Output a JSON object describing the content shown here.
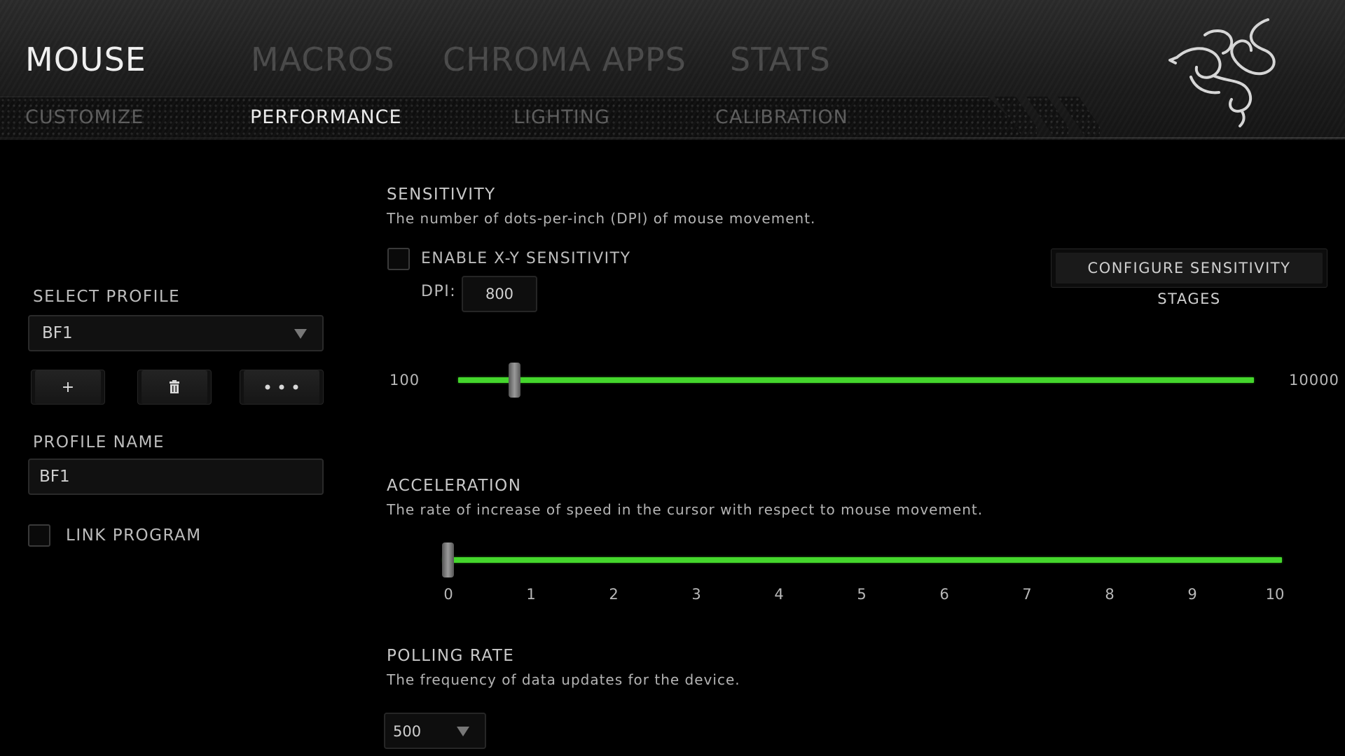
{
  "header": {
    "main_tabs": [
      {
        "label": "MOUSE",
        "active": true
      },
      {
        "label": "MACROS",
        "active": false
      },
      {
        "label": "CHROMA APPS",
        "active": false
      },
      {
        "label": "STATS",
        "active": false
      }
    ],
    "sub_tabs": [
      {
        "label": "CUSTOMIZE",
        "active": false
      },
      {
        "label": "PERFORMANCE",
        "active": true
      },
      {
        "label": "LIGHTING",
        "active": false
      },
      {
        "label": "CALIBRATION",
        "active": false
      }
    ],
    "logo_icon": "razer-snake-logo-icon"
  },
  "profile": {
    "select_label": "SELECT PROFILE",
    "selected": "BF1",
    "add_symbol": "+",
    "delete_icon": "trash-icon",
    "more_icon": "ellipsis-icon",
    "name_label": "PROFILE NAME",
    "name_value": "BF1",
    "link_program_label": "LINK PROGRAM",
    "link_program_checked": false
  },
  "sensitivity": {
    "title": "SENSITIVITY",
    "description": "The number of dots-per-inch (DPI) of mouse movement.",
    "enable_xy_label": "ENABLE X-Y SENSITIVITY",
    "enable_xy_checked": false,
    "dpi_label": "DPI:",
    "dpi_value": "800",
    "configure_button": "CONFIGURE SENSITIVITY STAGES",
    "min_label": "100",
    "max_label": "10000",
    "min": 100,
    "max": 10000,
    "value": 800
  },
  "acceleration": {
    "title": "ACCELERATION",
    "description": "The rate of increase of speed in the cursor with respect to mouse movement.",
    "ticks": [
      "0",
      "1",
      "2",
      "3",
      "4",
      "5",
      "6",
      "7",
      "8",
      "9",
      "10"
    ],
    "min": 0,
    "max": 10,
    "value": 0
  },
  "polling": {
    "title": "POLLING RATE",
    "description": "The frequency of data updates for the device.",
    "selected": "500"
  },
  "colors": {
    "accent": "#44d62c",
    "active_text": "#f2f2f2",
    "inactive_text": "#4a4a4a"
  }
}
